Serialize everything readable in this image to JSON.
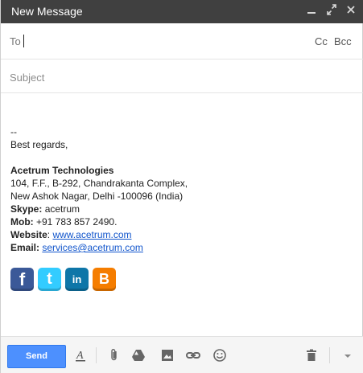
{
  "window": {
    "title": "New Message",
    "controls": {
      "minimize": "minimize-icon",
      "popout": "expand-icon",
      "close": "close-icon"
    }
  },
  "to": {
    "label": "To",
    "value": "",
    "cc_label": "Cc",
    "bcc_label": "Bcc"
  },
  "subject": {
    "placeholder": "Subject",
    "value": ""
  },
  "body": {
    "separator": "--",
    "greeting": "Best regards,",
    "company": "Acetrum Technologies",
    "address_line1": "104, F.F., B-292, Chandrakanta Complex,",
    "address_line2": "New Ashok Nagar, Delhi -100096 (India)",
    "skype_label": "Skype:",
    "skype_value": " acetrum",
    "mob_label": "Mob:",
    "mob_value": " +91 783 857 2490.",
    "website_label": "Website",
    "website_sep": ": ",
    "website_value": "www.acetrum.com",
    "email_label": "Email:",
    "email_value": "services@acetrum.com"
  },
  "socials": [
    {
      "name": "facebook",
      "glyph": "f",
      "color": "#3b5998"
    },
    {
      "name": "twitter",
      "glyph": "t",
      "color": "#33ccff"
    },
    {
      "name": "linkedin",
      "glyph": "in",
      "color": "#0e76a8"
    },
    {
      "name": "blogger",
      "glyph": "B",
      "color": "#f57d00"
    }
  ],
  "toolbar": {
    "send_label": "Send",
    "icons": [
      "formatting-icon",
      "attach-icon",
      "drive-icon",
      "insert-photo-icon",
      "insert-link-icon",
      "emoji-icon",
      "trash-icon",
      "more-options-icon"
    ]
  },
  "colors": {
    "titlebar": "#404040",
    "send_button": "#4d90fe",
    "link": "#1155cc"
  }
}
